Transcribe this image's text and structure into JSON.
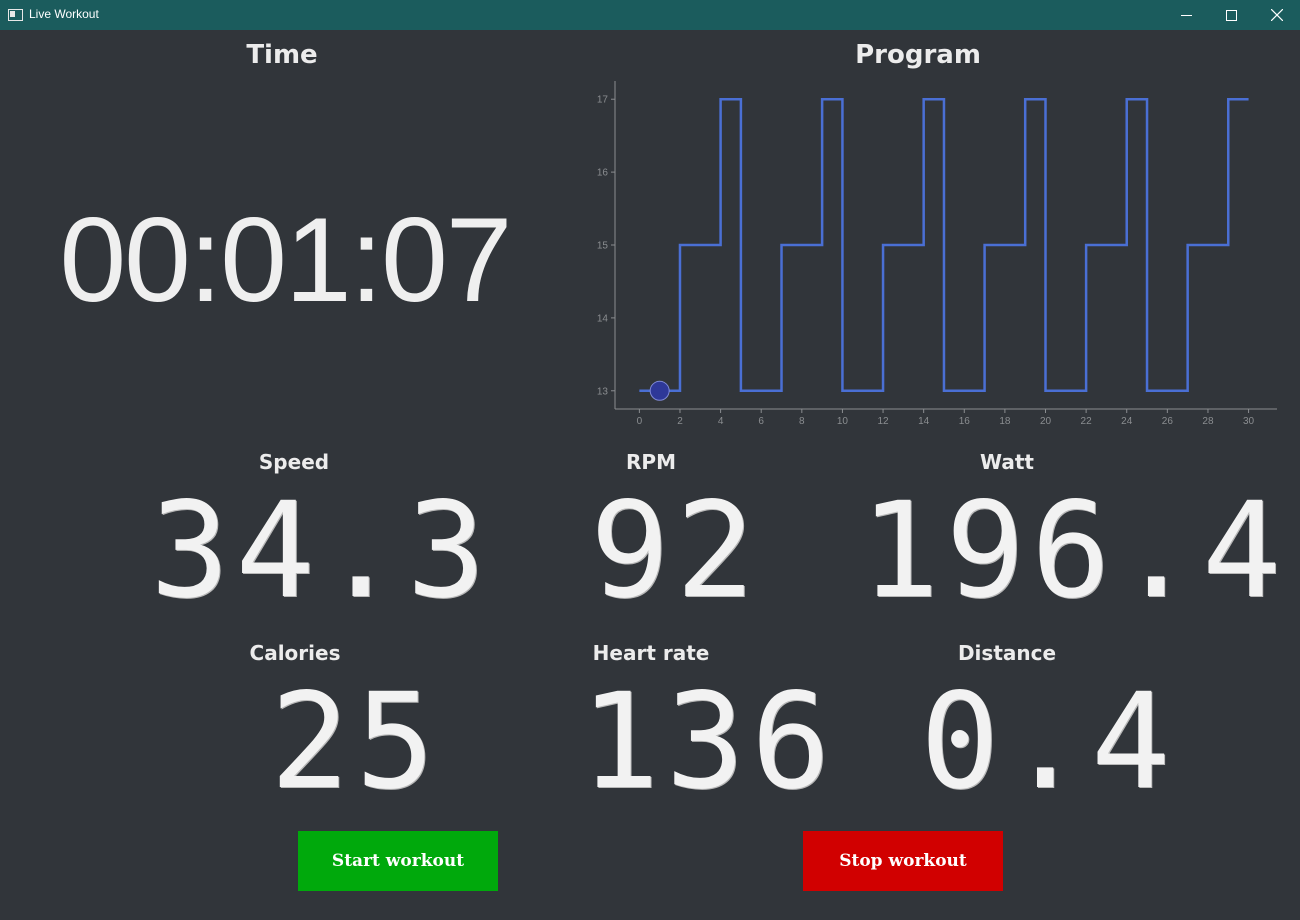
{
  "window": {
    "title": "Live Workout"
  },
  "time": {
    "heading": "Time",
    "clock": "00:01:07"
  },
  "program": {
    "heading": "Program",
    "chart_data": {
      "type": "line",
      "title": "",
      "xlabel": "",
      "ylabel": "",
      "xlim": [
        -1.2,
        31.4
      ],
      "ylim": [
        12.75,
        17.25
      ],
      "xticks": [
        0,
        2,
        4,
        6,
        8,
        10,
        12,
        14,
        16,
        18,
        20,
        22,
        24,
        26,
        28,
        30
      ],
      "yticks": [
        13,
        14,
        15,
        16,
        17
      ],
      "step": true,
      "series": [
        {
          "x": [
            0,
            2,
            4,
            5,
            7,
            9,
            10,
            12,
            14,
            15,
            17,
            19,
            20,
            22,
            24,
            25,
            27,
            29,
            30
          ],
          "y": [
            13,
            15,
            17,
            13,
            15,
            17,
            13,
            15,
            17,
            13,
            15,
            17,
            13,
            15,
            17,
            13,
            15,
            17,
            17
          ],
          "color": "#4a6fd4"
        }
      ],
      "marker": {
        "x": 1,
        "y": 13,
        "color": "#2e3898"
      },
      "grid": false
    }
  },
  "metrics": {
    "speed": {
      "label": "Speed",
      "value": "34.3"
    },
    "rpm": {
      "label": "RPM",
      "value": "92"
    },
    "watt": {
      "label": "Watt",
      "value": "196.4"
    },
    "calories": {
      "label": "Calories",
      "value": "25"
    },
    "heart_rate": {
      "label": "Heart rate",
      "value": "136"
    },
    "distance": {
      "label": "Distance",
      "value": "0.4"
    }
  },
  "buttons": {
    "start": {
      "label": "Start workout",
      "color": "#00a90c"
    },
    "stop": {
      "label": "Stop workout",
      "color": "#d10000"
    }
  },
  "colors": {
    "background": "#31353a",
    "titlebar": "#1b5c5d",
    "axis": "#8a8d90"
  }
}
